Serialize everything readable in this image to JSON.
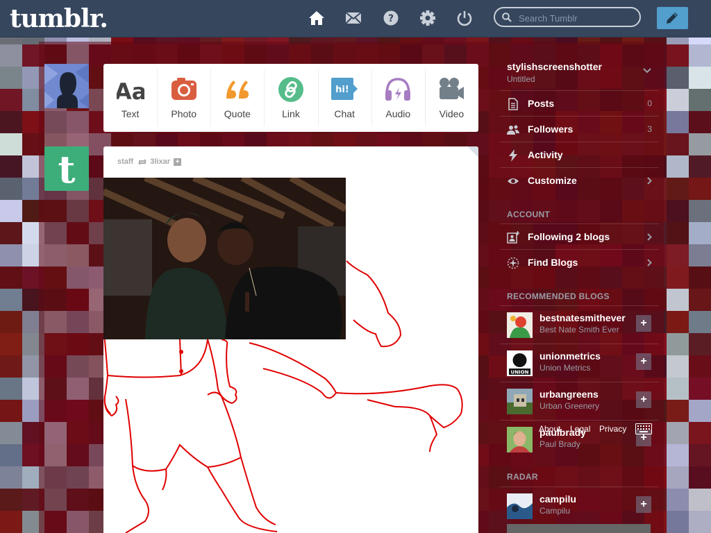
{
  "header": {
    "logo": "tumblr.",
    "nav": [
      {
        "name": "home-icon"
      },
      {
        "name": "inbox-icon"
      },
      {
        "name": "help-icon"
      },
      {
        "name": "settings-icon"
      },
      {
        "name": "logout-icon"
      }
    ],
    "search_placeholder": "Search Tumblr",
    "compose_icon": "pencil-icon"
  },
  "post_types": [
    {
      "label": "Text",
      "icon": "text-icon",
      "color": "#444444"
    },
    {
      "label": "Photo",
      "icon": "camera-icon",
      "color": "#d95e40"
    },
    {
      "label": "Quote",
      "icon": "quote-icon",
      "color": "#f2992e"
    },
    {
      "label": "Link",
      "icon": "link-icon",
      "color": "#56bc8a"
    },
    {
      "label": "Chat",
      "icon": "chat-icon",
      "color": "#529ecc"
    },
    {
      "label": "Audio",
      "icon": "headphones-icon",
      "color": "#a77dc2"
    },
    {
      "label": "Video",
      "icon": "video-camera-icon",
      "color": "#748089"
    }
  ],
  "post": {
    "author": "staff",
    "reblogged_from": "3lixar",
    "follow_icon": "plus-icon",
    "chat_bubble": "hi!"
  },
  "sidebar": {
    "blog_name": "stylishscreenshotter",
    "blog_title": "Untitled",
    "items": [
      {
        "label": "Posts",
        "count": "0",
        "icon": "posts-icon"
      },
      {
        "label": "Followers",
        "count": "3",
        "icon": "followers-icon"
      },
      {
        "label": "Activity",
        "count": "",
        "icon": "activity-icon"
      },
      {
        "label": "Customize",
        "count": "",
        "icon": "eye-icon"
      }
    ],
    "account_heading": "ACCOUNT",
    "account_items": [
      {
        "label": "Following 2 blogs",
        "icon": "following-icon"
      },
      {
        "label": "Find Blogs",
        "icon": "find-blogs-icon"
      }
    ],
    "recommended_heading": "RECOMMENDED BLOGS",
    "recommended": [
      {
        "name": "bestnatesmithever",
        "title": "Best Nate Smith Ever"
      },
      {
        "name": "unionmetrics",
        "title": "Union Metrics",
        "avatar_text": "UNION"
      },
      {
        "name": "urbangreens",
        "title": "Urban Greenery"
      },
      {
        "name": "paulbrady",
        "title": "Paul Brady"
      }
    ],
    "radar_heading": "RADAR",
    "radar": {
      "name": "campilu",
      "title": "Campilu"
    }
  },
  "footer": {
    "about": "About",
    "legal": "Legal",
    "privacy": "Privacy",
    "keyboard_icon": "keyboard-icon"
  },
  "colors": {
    "header_bg": "#36465d",
    "compose_bg": "#529ecc",
    "sidebar_text_muted": "#9a9da6"
  }
}
